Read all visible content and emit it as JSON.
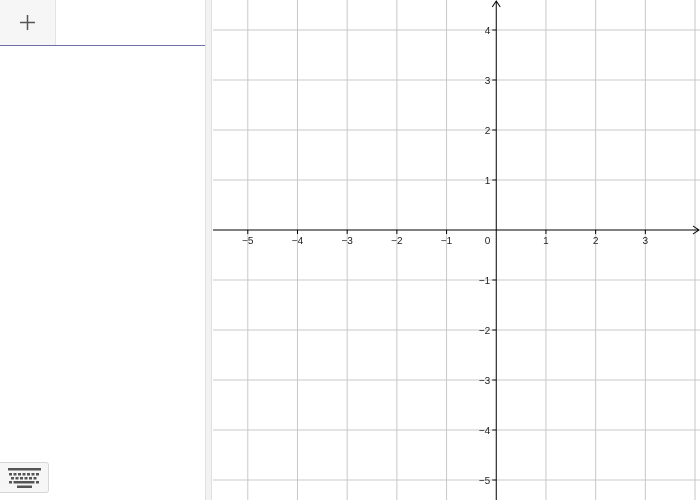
{
  "algebra": {
    "add_button_icon": "plus-icon",
    "input_value": "",
    "keyboard_icon": "keyboard-icon"
  },
  "graphics": {
    "x_range": [
      -5.7,
      4.1
    ],
    "y_range": [
      -5.4,
      4.6
    ],
    "grid_step": 1,
    "grid": true,
    "colors": {
      "grid": "#c8c8c8",
      "axis": "#000000"
    },
    "x_ticks": [
      {
        "value": -5,
        "label": "−5"
      },
      {
        "value": -4,
        "label": "−4"
      },
      {
        "value": -3,
        "label": "−3"
      },
      {
        "value": -2,
        "label": "−2"
      },
      {
        "value": -1,
        "label": "−1"
      },
      {
        "value": 1,
        "label": "1"
      },
      {
        "value": 2,
        "label": "2"
      },
      {
        "value": 3,
        "label": "3"
      }
    ],
    "y_ticks": [
      {
        "value": 4,
        "label": "4"
      },
      {
        "value": 3,
        "label": "3"
      },
      {
        "value": 2,
        "label": "2"
      },
      {
        "value": 1,
        "label": "1"
      },
      {
        "value": -1,
        "label": "−1"
      },
      {
        "value": -2,
        "label": "−2"
      },
      {
        "value": -3,
        "label": "−3"
      },
      {
        "value": -4,
        "label": "−4"
      },
      {
        "value": -5,
        "label": "−5"
      }
    ],
    "origin_label": "0"
  }
}
